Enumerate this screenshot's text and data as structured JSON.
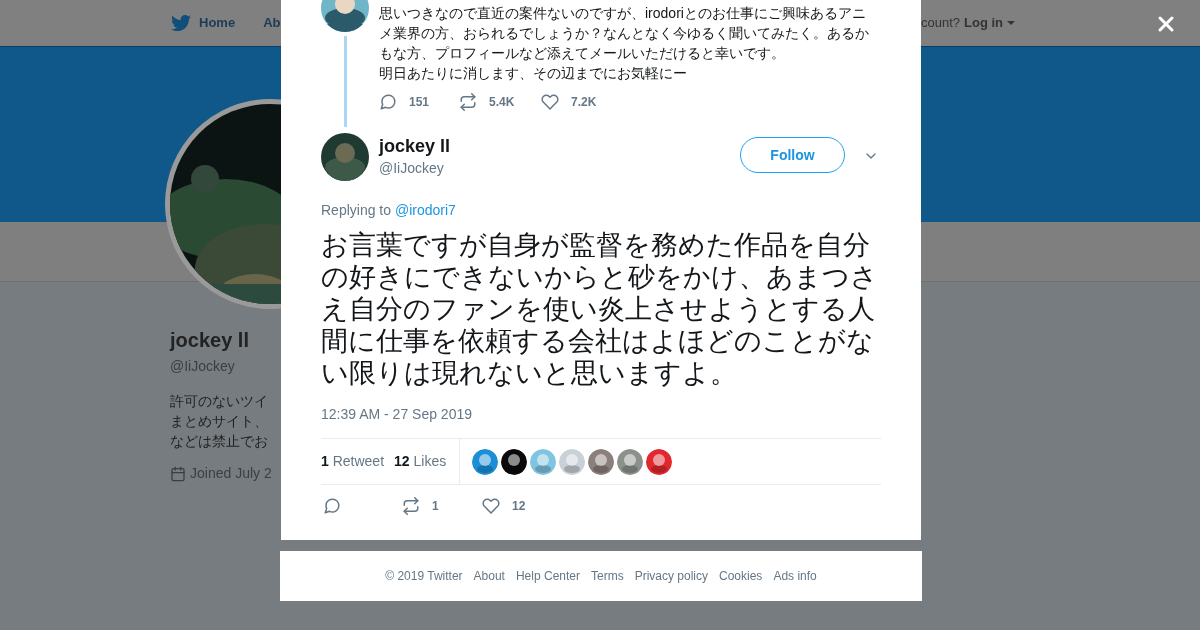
{
  "nav": {
    "items": [
      {
        "label": "Home"
      },
      {
        "label": "Ab"
      }
    ],
    "account_prompt": "count?",
    "login": "Log in"
  },
  "profile": {
    "name": "jockey ll",
    "handle": "@IiJockey",
    "bio": [
      "許可のないツイ",
      "まとめサイト、",
      "などは禁止でお"
    ],
    "joined": "Joined July 2"
  },
  "previous_tweet": {
    "paragraphs": [
      "思いつきなので直近の案件ないのですが、irodoriとのお仕事にご興味あるアニメ業界の方、おられるでしょうか？なんとなく今ゆるく聞いてみたく。あるかもな方、プロフィールなど添えてメールいただけると幸いです。",
      "明日あたりに消します、その辺までにお気軽にー"
    ],
    "replies": "151",
    "retweets": "5.4K",
    "likes": "7.2K"
  },
  "tweet": {
    "name": "jockey ll",
    "handle": "@IiJockey",
    "follow": "Follow",
    "replying_label": "Replying to",
    "replying_to": "@irodori7",
    "text": "お言葉ですが自身が監督を務めた作品を自分の好きにできないからと砂をかけ、あまつさえ自分のファンを使い炎上させようとする人間に仕事を依頼する会社はよほどのことがない限りは現れないと思いますよ。",
    "timestamp": "12:39 AM - 27 Sep 2019",
    "retweet_count": "1",
    "retweet_label": "Retweet",
    "like_count": "12",
    "like_label": "Likes",
    "likers": [
      {
        "color": "#1b8fd6"
      },
      {
        "color": "#0a0a0a"
      },
      {
        "color": "#7fc4e0"
      },
      {
        "color": "#c8d0d8"
      },
      {
        "color": "#8a7f7a"
      },
      {
        "color": "#8d918c"
      },
      {
        "color": "#e0282e"
      }
    ],
    "action_retweets": "1",
    "action_likes": "12"
  },
  "footer": [
    "© 2019 Twitter",
    "About",
    "Help Center",
    "Terms",
    "Privacy policy",
    "Cookies",
    "Ads info"
  ]
}
